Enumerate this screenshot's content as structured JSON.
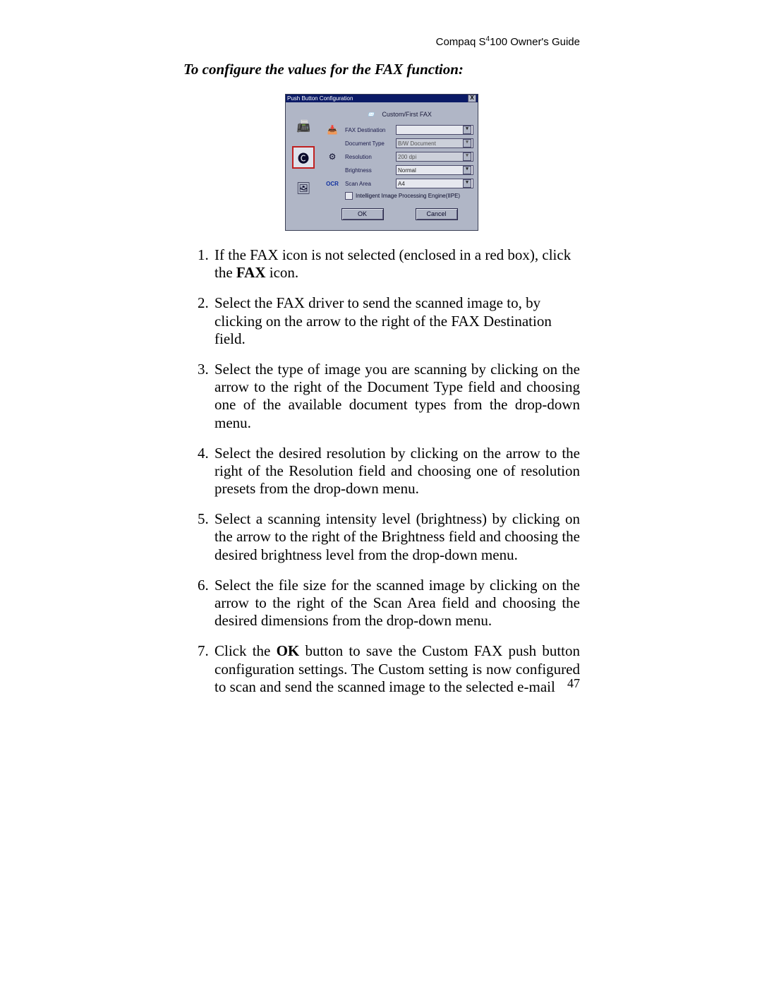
{
  "header": {
    "brand": "Compaq S",
    "super": "4",
    "rest": "100 Owner's Guide"
  },
  "section_title": "To configure the values for the FAX function:",
  "dialog": {
    "title": "Push Button Configuration",
    "close": "X",
    "header_label": "Custom/First FAX",
    "side_icons": [
      "scanner-icon",
      "copy-icon",
      "photo-icon"
    ],
    "ocr_label": "OCR",
    "fields": {
      "dest": {
        "label": "FAX Destination",
        "value": ""
      },
      "type": {
        "label": "Document Type",
        "value": "B/W Document"
      },
      "res": {
        "label": "Resolution",
        "value": "200 dpi"
      },
      "bright": {
        "label": "Brightness",
        "value": "Normal"
      },
      "area": {
        "label": "Scan Area",
        "value": "A4"
      }
    },
    "checkbox_label": "Intelligent Image Processing Engine(IIPE)",
    "buttons": {
      "ok": "OK",
      "cancel": "Cancel"
    }
  },
  "steps": [
    {
      "n": "1.",
      "pre": "If the FAX icon is not selected (enclosed in a red box), click the ",
      "bold": "FAX",
      "post": " icon.",
      "justify": false
    },
    {
      "n": "2.",
      "pre": "Select the FAX driver to send the scanned image to, by clicking on the arrow to the right of the FAX Destination field.",
      "bold": "",
      "post": "",
      "justify": false
    },
    {
      "n": "3.",
      "pre": "Select the type of image you are scanning by clicking on the arrow to the right of the Document Type field and choosing one of the available document types from the drop-down menu.",
      "bold": "",
      "post": "",
      "justify": true
    },
    {
      "n": "4.",
      "pre": "Select the desired resolution by clicking on the arrow to the right of the Resolution field and choosing one of resolution presets from the drop-down menu.",
      "bold": "",
      "post": "",
      "justify": true
    },
    {
      "n": "5.",
      "pre": "Select a scanning intensity level (brightness) by clicking on the arrow to the right of the Brightness field and choosing the desired brightness level from the drop-down menu.",
      "bold": "",
      "post": "",
      "justify": true
    },
    {
      "n": "6.",
      "pre": "Select the file size for the scanned image by clicking on the arrow to the right of the Scan Area field and choosing the desired dimensions from the drop-down menu.",
      "bold": "",
      "post": "",
      "justify": true
    },
    {
      "n": "7.",
      "pre": "Click the ",
      "bold": "OK",
      "post": " button to save the Custom FAX push button configuration settings. The Custom setting is now configured to scan and send the scanned image to the selected e-mail",
      "justify": true
    }
  ],
  "page_number": "47"
}
